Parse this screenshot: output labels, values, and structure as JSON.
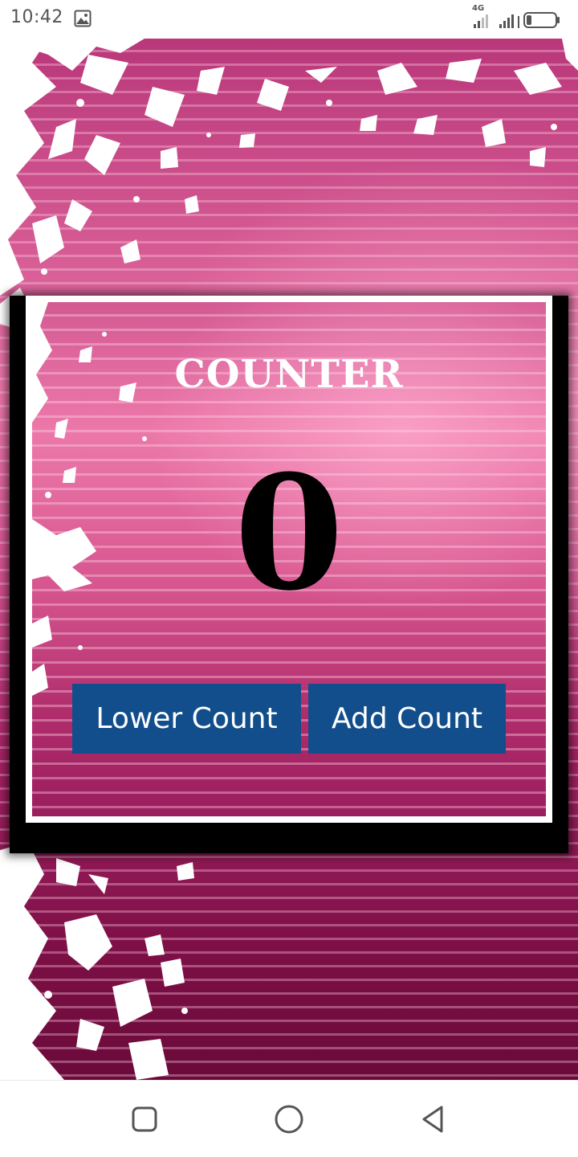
{
  "status_bar": {
    "time": "10:42",
    "network_type": "4G"
  },
  "counter": {
    "title": "COUNTER",
    "value": "0"
  },
  "buttons": {
    "lower_label": "Lower Count",
    "add_label": "Add Count"
  },
  "colors": {
    "button_bg": "#124e8c",
    "background_top": "#b9377a",
    "background_bottom": "#6a0a3a",
    "card_border": "#ffffff"
  },
  "icons": {
    "status_left": "gallery-icon",
    "status_right": [
      "network-4g-icon",
      "signal-icon",
      "signal-icon",
      "battery-icon"
    ],
    "nav": [
      "recent-apps-icon",
      "home-icon",
      "back-icon"
    ]
  }
}
